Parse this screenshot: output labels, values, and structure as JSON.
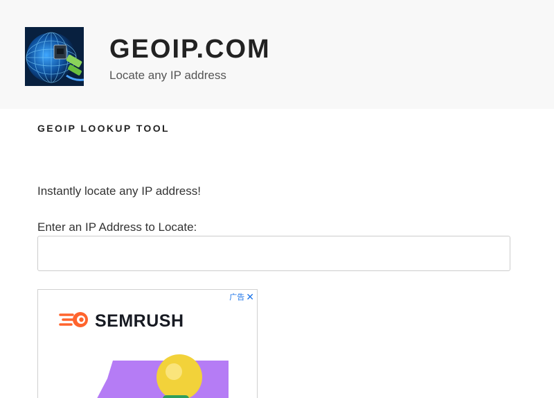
{
  "site": {
    "title": "GEOIP.COM",
    "description": "Locate any IP address",
    "logo_icon": "globe-network-cable-icon"
  },
  "page": {
    "title": "GEOIP LOOKUP TOOL",
    "intro": "Instantly locate any IP address!",
    "ip_label": "Enter an IP Address to Locate:",
    "ip_value": ""
  },
  "ad": {
    "badge": "广告",
    "close_icon": "close-icon",
    "brand": "SEMRUSH",
    "brand_color": "#ff642d",
    "art_color": "#b57cf5",
    "art_icon": "lightbulb-icon"
  }
}
